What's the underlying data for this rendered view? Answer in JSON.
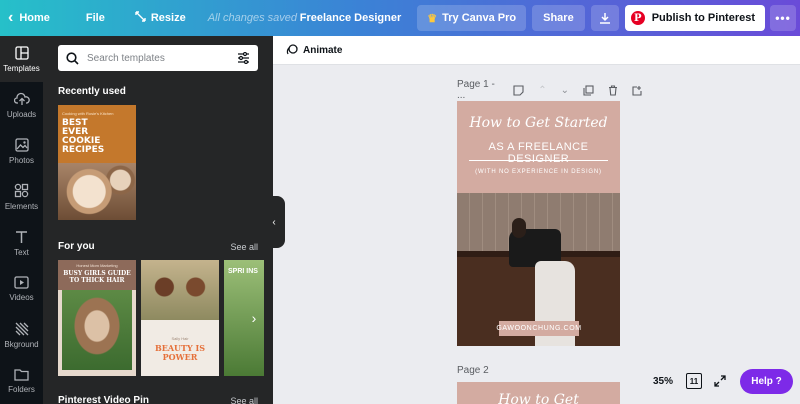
{
  "topbar": {
    "home_label": "Home",
    "file_label": "File",
    "resize_label": "Resize",
    "saved_status": "All changes saved",
    "design_title": "Freelance Designer",
    "try_pro_label": "Try Canva Pro",
    "share_label": "Share",
    "publish_label": "Publish to Pinterest",
    "more_label": "•••"
  },
  "rail": {
    "items": [
      {
        "label": "Templates",
        "icon": "templates-icon",
        "active": true
      },
      {
        "label": "Uploads",
        "icon": "upload-cloud-icon"
      },
      {
        "label": "Photos",
        "icon": "photo-icon"
      },
      {
        "label": "Elements",
        "icon": "shapes-icon"
      },
      {
        "label": "Text",
        "icon": "text-icon"
      },
      {
        "label": "Videos",
        "icon": "video-icon"
      },
      {
        "label": "Bkground",
        "icon": "background-icon"
      },
      {
        "label": "Folders",
        "icon": "folder-icon"
      }
    ]
  },
  "panel": {
    "search_placeholder": "Search templates",
    "recently_used_title": "Recently used",
    "for_you_title": "For you",
    "for_you_see_all": "See all",
    "video_pin_title": "Pinterest Video Pin",
    "video_pin_see_all": "See all",
    "recent_template": {
      "small_text": "Cooking with Rosie's Kitchen",
      "title": "BEST EVER COOKIE RECIPES"
    },
    "for_you_templates": [
      {
        "small_text": "Honest Mom Marketing",
        "title": "BUSY GIRLS GUIDE TO THICK HAIR"
      },
      {
        "small_text": "Sally Hair",
        "title": "BEAUTY IS POWER"
      },
      {
        "title": "SPRI INS"
      }
    ]
  },
  "toolbar": {
    "animate_label": "Animate"
  },
  "canvas": {
    "page1_label": "Page 1 - ...",
    "page1": {
      "title_line1": "How to Get Started",
      "title_line2": "AS A FREELANCE DESIGNER",
      "subtitle": "(WITH NO EXPERIENCE IN DESIGN)",
      "caption": "GAWOONCHUNG.COM"
    },
    "page2_label": "Page 2",
    "page2_title": "How to Get"
  },
  "footer": {
    "zoom": "35%",
    "page_count": "11",
    "help_label": "Help ?"
  },
  "colors": {
    "accent_purple": "#7d2ae8",
    "page_bg": "#d3aba1",
    "pinterest_red": "#e60023",
    "panel_dark": "#252627"
  }
}
